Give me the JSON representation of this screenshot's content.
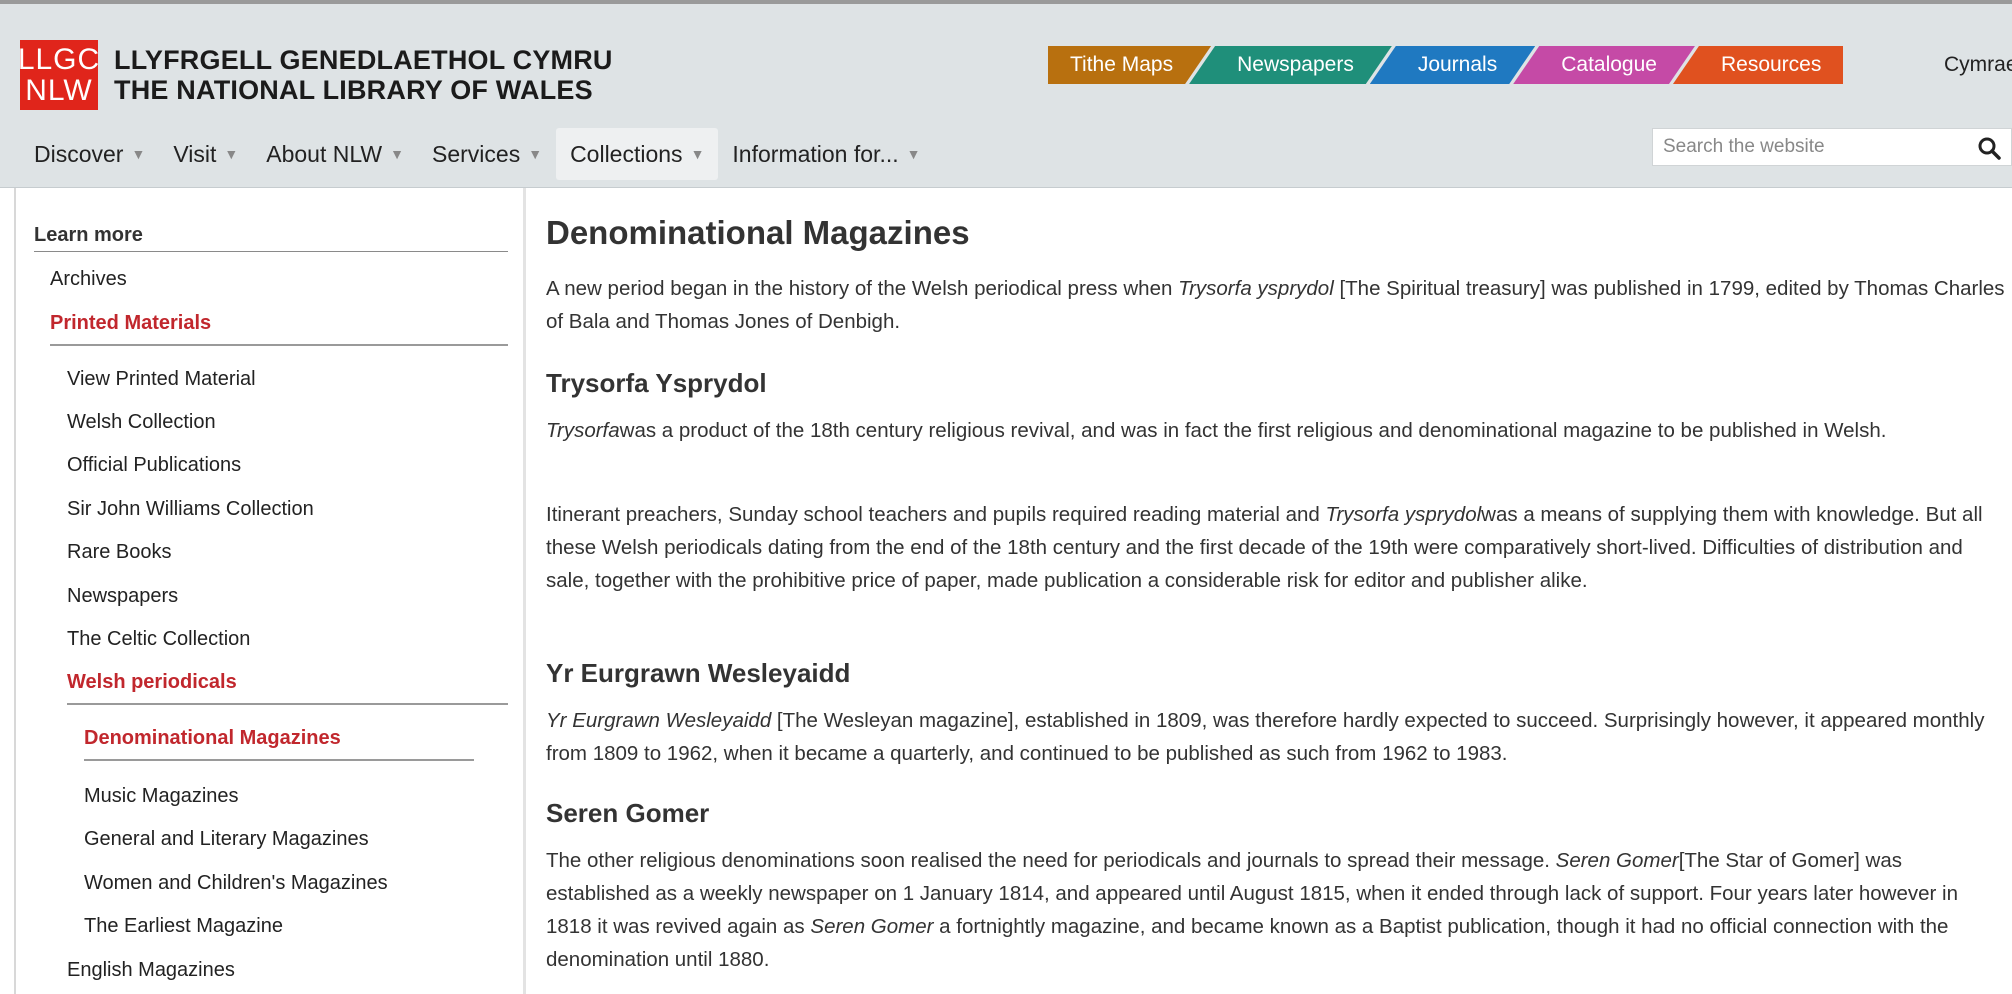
{
  "logo": {
    "lines": [
      "LLGC",
      "NLW"
    ],
    "title_cy": "LLYFRGELL GENEDLAETHOL CYMRU",
    "title_en": "THE NATIONAL LIBRARY OF WALES"
  },
  "top_tabs": [
    {
      "label": "Tithe Maps",
      "color": "#b8700f"
    },
    {
      "label": "Newspapers",
      "color": "#1f8f7a"
    },
    {
      "label": "Journals",
      "color": "#1f79c1"
    },
    {
      "label": "Catalogue",
      "color": "#c54aa6"
    },
    {
      "label": "Resources",
      "color": "#e0511f"
    }
  ],
  "language_link": "Cymraeg",
  "nav": [
    {
      "label": "Discover"
    },
    {
      "label": "Visit"
    },
    {
      "label": "About NLW"
    },
    {
      "label": "Services"
    },
    {
      "label": "Collections"
    },
    {
      "label": "Information for..."
    }
  ],
  "search": {
    "placeholder": "Search the website"
  },
  "sidebar": {
    "heading": "Learn more",
    "items": [
      "Archives",
      "Printed Materials",
      "View Printed Material",
      "Welsh Collection",
      "Official Publications",
      "Sir John Williams Collection",
      "Rare Books",
      "Newspapers",
      "The Celtic Collection",
      "Welsh periodicals",
      "Denominational Magazines",
      "Music Magazines",
      "General and Literary Magazines",
      "Women and Children's Magazines",
      "The Earliest Magazine",
      "English Magazines"
    ]
  },
  "article": {
    "title": "Denominational Magazines",
    "intro": {
      "before": "A new period began in the history of the Welsh periodical press when ",
      "italic": "Trysorfa ysprydol",
      "after": " [The Spiritual treasury] was published in 1799, edited by Thomas Charles of Bala and Thomas Jones of Denbigh."
    },
    "s1_heading": "Trysorfa Ysprydol",
    "s1_p1": {
      "italic": "Trysorfa",
      "after": "was a product of the 18th century religious revival, and was in fact the first religious and denominational magazine to be published in Welsh."
    },
    "s1_p2": {
      "before": "Itinerant preachers, Sunday school teachers and pupils required reading material and ",
      "italic": "Trysorfa ysprydol",
      "after": "was a means of supplying them with knowledge. But all these Welsh periodicals dating from the end of the 18th century and the first decade of the 19th were comparatively short-lived. Difficulties of distribution and sale, together with the prohibitive price of paper, made publication a considerable risk for editor and publisher alike."
    },
    "s2_heading": "Yr Eurgrawn Wesleyaidd",
    "s2_p1": {
      "italic": "Yr Eurgrawn Wesleyaidd",
      "after": " [The Wesleyan magazine], established in 1809, was therefore hardly expected to succeed. Surprisingly however, it appeared monthly from 1809 to 1962, when it became a quarterly, and continued to be published as such from 1962 to 1983."
    },
    "s3_heading": "Seren Gomer",
    "s3_p1": {
      "before": "The other religious denominations soon realised the need for periodicals and journals to spread their message. ",
      "italic": "Seren Gomer",
      "mid": "[The Star of Gomer] was established as a weekly newspaper on 1 January 1814, and appeared until August 1815, when it ended through lack of support. Four years later however in 1818 it was revived again as ",
      "italic2": "Seren Gomer",
      "after": " a fortnightly magazine, and became known as a Baptist publication, though it had no official connection with the denomination until 1880."
    }
  }
}
